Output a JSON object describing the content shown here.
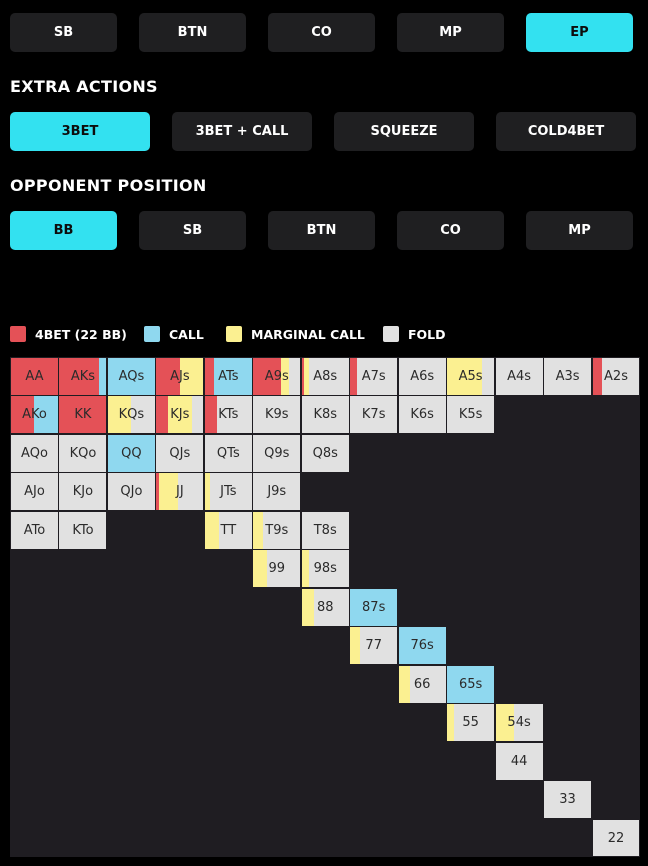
{
  "position_row": [
    {
      "label": "SB",
      "active": false
    },
    {
      "label": "BTN",
      "active": false
    },
    {
      "label": "CO",
      "active": false
    },
    {
      "label": "MP",
      "active": false
    },
    {
      "label": "EP",
      "active": true
    }
  ],
  "extra_actions": {
    "heading": "EXTRA ACTIONS",
    "buttons": [
      {
        "label": "3BET",
        "active": true
      },
      {
        "label": "3BET + CALL",
        "active": false
      },
      {
        "label": "SQUEEZE",
        "active": false
      },
      {
        "label": "COLD4BET",
        "active": false
      }
    ]
  },
  "opponent_position": {
    "heading": "OPPONENT POSITION",
    "buttons": [
      {
        "label": "BB",
        "active": true
      },
      {
        "label": "SB",
        "active": false
      },
      {
        "label": "BTN",
        "active": false
      },
      {
        "label": "CO",
        "active": false
      },
      {
        "label": "MP",
        "active": false
      }
    ]
  },
  "legend": [
    {
      "label": "4BET (22 BB)",
      "color": "#e45157",
      "action": "fourbet"
    },
    {
      "label": "CALL",
      "color": "#8fd8ef",
      "action": "call"
    },
    {
      "label": "MARGINAL CALL",
      "color": "#fbf091",
      "action": "marginal"
    },
    {
      "label": "FOLD",
      "color": "#e1e1e1",
      "action": "fold"
    }
  ],
  "grid": {
    "background": "#1f1d22",
    "hands": [
      {
        "label": "AA",
        "row": 0,
        "col": 0,
        "fourbet": 100,
        "call": 0,
        "marginal": 0
      },
      {
        "label": "AKs",
        "row": 0,
        "col": 1,
        "fourbet": 85,
        "call": 15,
        "marginal": 0
      },
      {
        "label": "AQs",
        "row": 0,
        "col": 2,
        "fourbet": 0,
        "call": 100,
        "marginal": 0
      },
      {
        "label": "AJs",
        "row": 0,
        "col": 3,
        "fourbet": 50,
        "call": 0,
        "marginal": 50
      },
      {
        "label": "ATs",
        "row": 0,
        "col": 4,
        "fourbet": 20,
        "call": 80,
        "marginal": 0
      },
      {
        "label": "A9s",
        "row": 0,
        "col": 5,
        "fourbet": 60,
        "call": 0,
        "marginal": 15
      },
      {
        "label": "A8s",
        "row": 0,
        "col": 6,
        "fourbet": 5,
        "call": 0,
        "marginal": 10
      },
      {
        "label": "A7s",
        "row": 0,
        "col": 7,
        "fourbet": 15,
        "call": 0,
        "marginal": 0
      },
      {
        "label": "A6s",
        "row": 0,
        "col": 8,
        "fourbet": 0,
        "call": 0,
        "marginal": 0
      },
      {
        "label": "A5s",
        "row": 0,
        "col": 9,
        "fourbet": 0,
        "call": 0,
        "marginal": 75
      },
      {
        "label": "A4s",
        "row": 0,
        "col": 10,
        "fourbet": 0,
        "call": 0,
        "marginal": 0
      },
      {
        "label": "A3s",
        "row": 0,
        "col": 11,
        "fourbet": 0,
        "call": 0,
        "marginal": 0
      },
      {
        "label": "A2s",
        "row": 0,
        "col": 12,
        "fourbet": 20,
        "call": 0,
        "marginal": 0
      },
      {
        "label": "AKo",
        "row": 1,
        "col": 0,
        "fourbet": 50,
        "call": 50,
        "marginal": 0
      },
      {
        "label": "KK",
        "row": 1,
        "col": 1,
        "fourbet": 100,
        "call": 0,
        "marginal": 0
      },
      {
        "label": "KQs",
        "row": 1,
        "col": 2,
        "fourbet": 0,
        "call": 0,
        "marginal": 50
      },
      {
        "label": "KJs",
        "row": 1,
        "col": 3,
        "fourbet": 25,
        "call": 0,
        "marginal": 50
      },
      {
        "label": "KTs",
        "row": 1,
        "col": 4,
        "fourbet": 25,
        "call": 0,
        "marginal": 0
      },
      {
        "label": "K9s",
        "row": 1,
        "col": 5,
        "fourbet": 0,
        "call": 0,
        "marginal": 0
      },
      {
        "label": "K8s",
        "row": 1,
        "col": 6,
        "fourbet": 0,
        "call": 0,
        "marginal": 0
      },
      {
        "label": "K7s",
        "row": 1,
        "col": 7,
        "fourbet": 0,
        "call": 0,
        "marginal": 0
      },
      {
        "label": "K6s",
        "row": 1,
        "col": 8,
        "fourbet": 0,
        "call": 0,
        "marginal": 0
      },
      {
        "label": "K5s",
        "row": 1,
        "col": 9,
        "fourbet": 0,
        "call": 0,
        "marginal": 0
      },
      {
        "label": "AQo",
        "row": 2,
        "col": 0,
        "fourbet": 0,
        "call": 0,
        "marginal": 0
      },
      {
        "label": "KQo",
        "row": 2,
        "col": 1,
        "fourbet": 0,
        "call": 0,
        "marginal": 0
      },
      {
        "label": "QQ",
        "row": 2,
        "col": 2,
        "fourbet": 0,
        "call": 100,
        "marginal": 0
      },
      {
        "label": "QJs",
        "row": 2,
        "col": 3,
        "fourbet": 0,
        "call": 0,
        "marginal": 0
      },
      {
        "label": "QTs",
        "row": 2,
        "col": 4,
        "fourbet": 0,
        "call": 0,
        "marginal": 0
      },
      {
        "label": "Q9s",
        "row": 2,
        "col": 5,
        "fourbet": 0,
        "call": 0,
        "marginal": 0
      },
      {
        "label": "Q8s",
        "row": 2,
        "col": 6,
        "fourbet": 0,
        "call": 0,
        "marginal": 0
      },
      {
        "label": "AJo",
        "row": 3,
        "col": 0,
        "fourbet": 0,
        "call": 0,
        "marginal": 0
      },
      {
        "label": "KJo",
        "row": 3,
        "col": 1,
        "fourbet": 0,
        "call": 0,
        "marginal": 0
      },
      {
        "label": "QJo",
        "row": 3,
        "col": 2,
        "fourbet": 0,
        "call": 0,
        "marginal": 0
      },
      {
        "label": "JJ",
        "row": 3,
        "col": 3,
        "fourbet": 5,
        "call": 0,
        "marginal": 40
      },
      {
        "label": "JTs",
        "row": 3,
        "col": 4,
        "fourbet": 0,
        "call": 0,
        "marginal": 10
      },
      {
        "label": "J9s",
        "row": 3,
        "col": 5,
        "fourbet": 0,
        "call": 0,
        "marginal": 0
      },
      {
        "label": "ATo",
        "row": 4,
        "col": 0,
        "fourbet": 0,
        "call": 0,
        "marginal": 0
      },
      {
        "label": "KTo",
        "row": 4,
        "col": 1,
        "fourbet": 0,
        "call": 0,
        "marginal": 0
      },
      {
        "label": "TT",
        "row": 4,
        "col": 4,
        "fourbet": 0,
        "call": 0,
        "marginal": 30
      },
      {
        "label": "T9s",
        "row": 4,
        "col": 5,
        "fourbet": 0,
        "call": 0,
        "marginal": 20
      },
      {
        "label": "T8s",
        "row": 4,
        "col": 6,
        "fourbet": 0,
        "call": 0,
        "marginal": 0
      },
      {
        "label": "99",
        "row": 5,
        "col": 5,
        "fourbet": 0,
        "call": 0,
        "marginal": 30
      },
      {
        "label": "98s",
        "row": 5,
        "col": 6,
        "fourbet": 0,
        "call": 0,
        "marginal": 15
      },
      {
        "label": "88",
        "row": 6,
        "col": 6,
        "fourbet": 0,
        "call": 0,
        "marginal": 25
      },
      {
        "label": "87s",
        "row": 6,
        "col": 7,
        "fourbet": 0,
        "call": 100,
        "marginal": 0
      },
      {
        "label": "77",
        "row": 7,
        "col": 7,
        "fourbet": 0,
        "call": 0,
        "marginal": 20
      },
      {
        "label": "76s",
        "row": 7,
        "col": 8,
        "fourbet": 0,
        "call": 100,
        "marginal": 0
      },
      {
        "label": "66",
        "row": 8,
        "col": 8,
        "fourbet": 0,
        "call": 0,
        "marginal": 25
      },
      {
        "label": "65s",
        "row": 8,
        "col": 9,
        "fourbet": 0,
        "call": 100,
        "marginal": 0
      },
      {
        "label": "55",
        "row": 9,
        "col": 9,
        "fourbet": 0,
        "call": 0,
        "marginal": 15
      },
      {
        "label": "54s",
        "row": 9,
        "col": 10,
        "fourbet": 0,
        "call": 0,
        "marginal": 40
      },
      {
        "label": "44",
        "row": 10,
        "col": 10,
        "fourbet": 0,
        "call": 0,
        "marginal": 0
      },
      {
        "label": "33",
        "row": 11,
        "col": 11,
        "fourbet": 0,
        "call": 0,
        "marginal": 0
      },
      {
        "label": "22",
        "row": 12,
        "col": 12,
        "fourbet": 0,
        "call": 0,
        "marginal": 0
      }
    ]
  }
}
